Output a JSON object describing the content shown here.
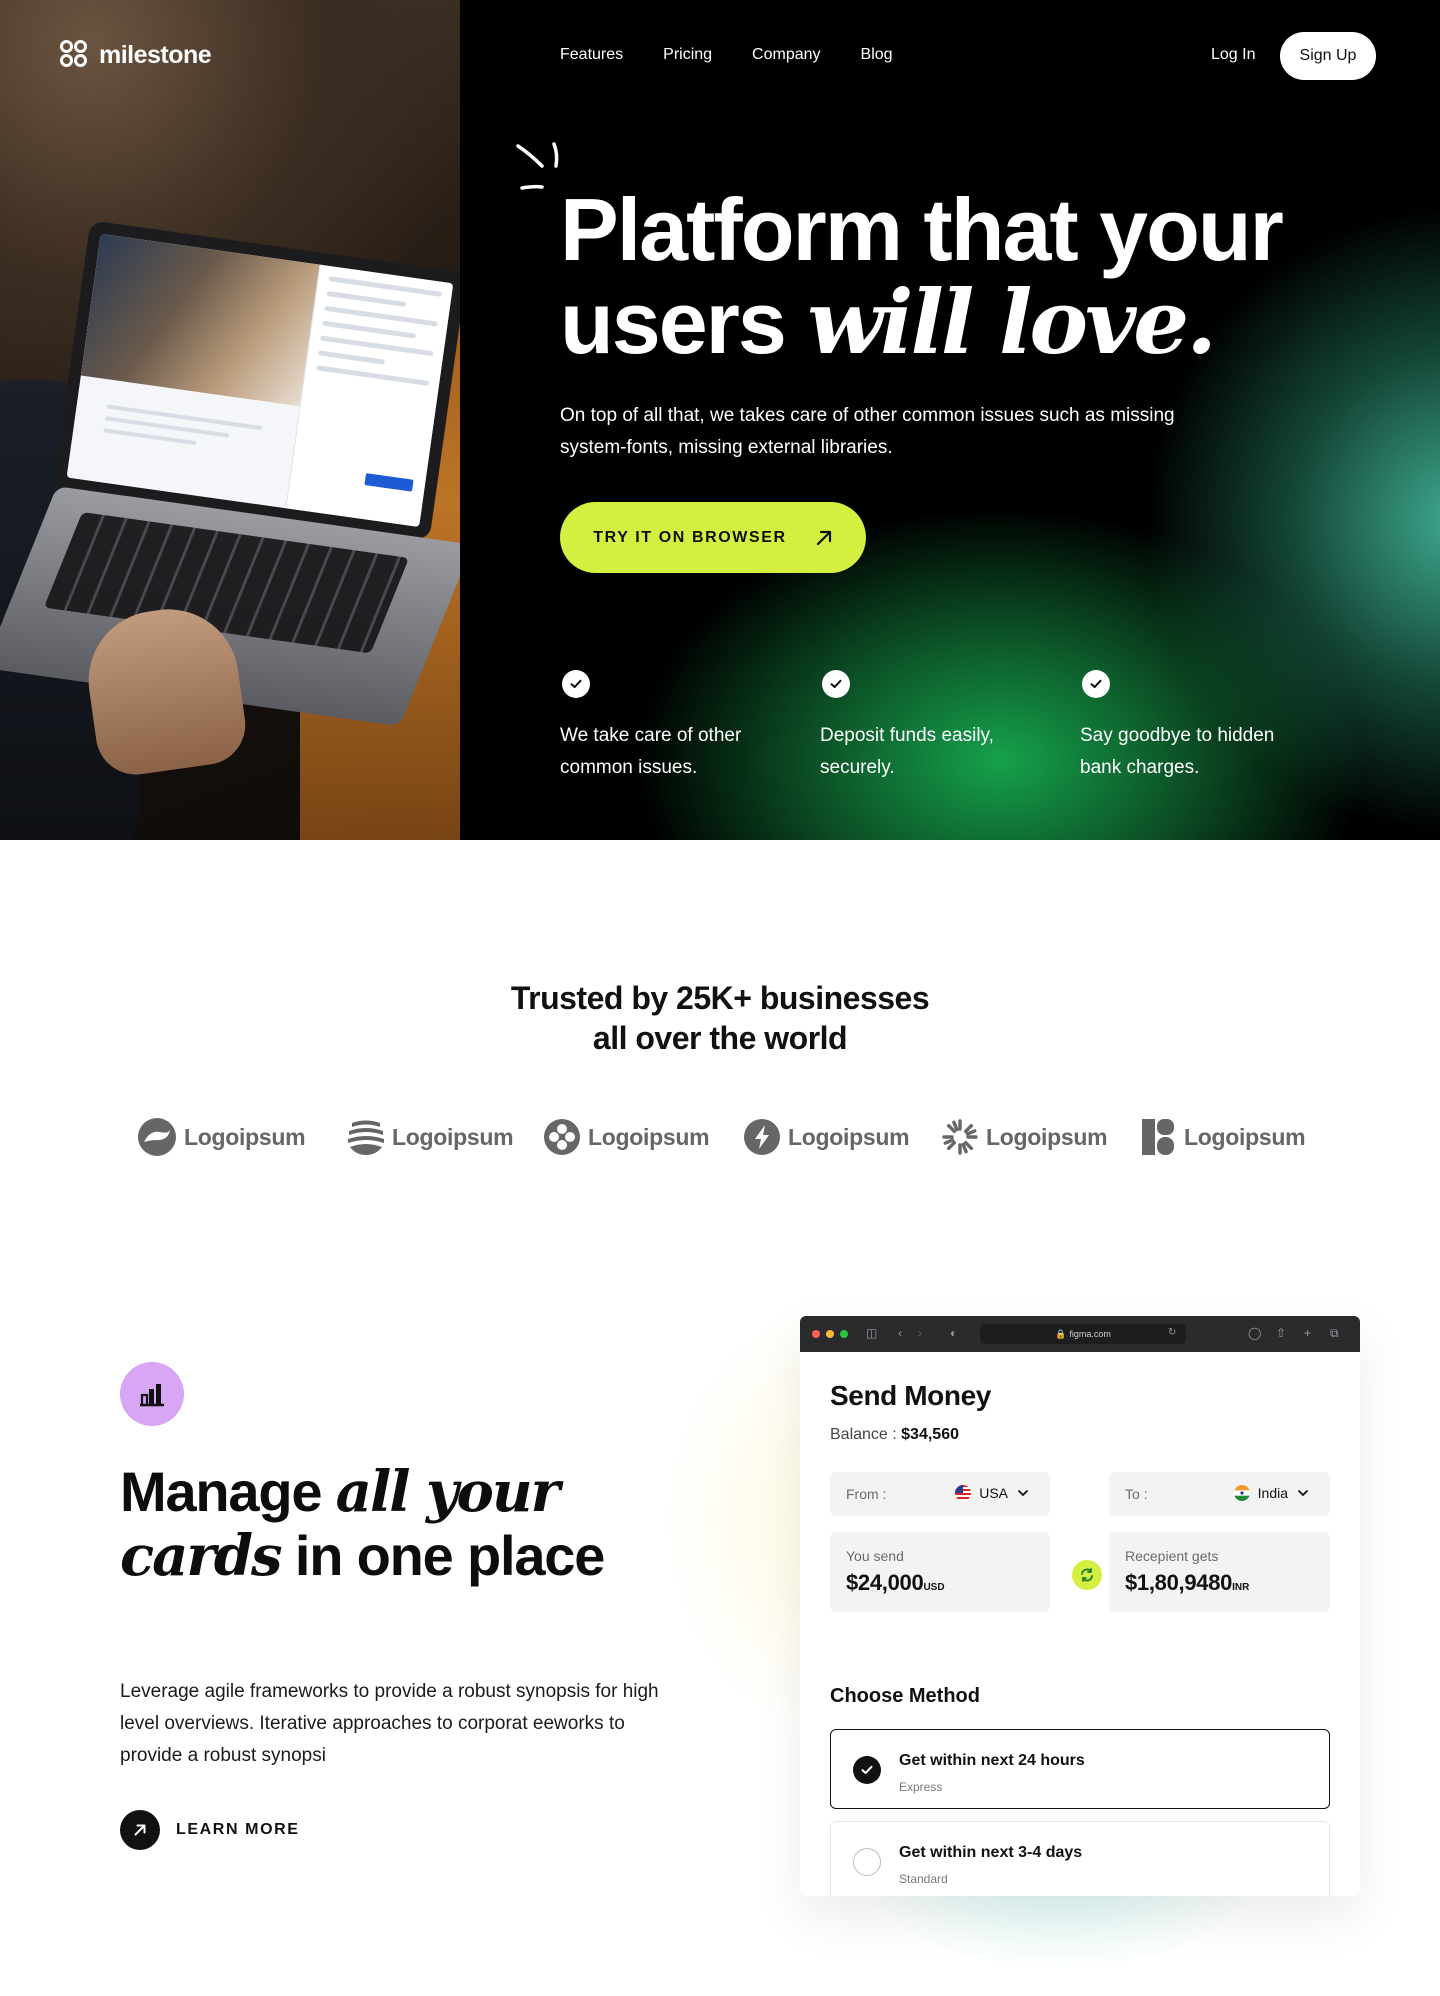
{
  "brand": {
    "name": "milestone"
  },
  "nav": {
    "items": [
      {
        "label": "Features"
      },
      {
        "label": "Pricing"
      },
      {
        "label": "Company"
      },
      {
        "label": "Blog"
      }
    ],
    "login_label": "Log In",
    "signup_label": "Sign Up"
  },
  "hero": {
    "title_line1": "Platform that your",
    "title_line2_plain": "users ",
    "title_line2_italic": "will love.",
    "subtitle": "On top of all that, we takes care of other common issues such as missing system-fonts, missing external libraries.",
    "cta_label": "TRY IT ON BROWSER",
    "features": [
      {
        "text": "We take care of other common issues."
      },
      {
        "text": "Deposit funds easily, securely."
      },
      {
        "text": "Say goodbye to hidden bank charges."
      }
    ]
  },
  "trusted": {
    "title_line1": "Trusted by 25K+ businesses",
    "title_line2": "all over the world",
    "logos": [
      {
        "label": "Logoipsum",
        "icon": "swirl-circle-icon"
      },
      {
        "label": "Logoipsum",
        "icon": "wave-stripes-icon"
      },
      {
        "label": "Logoipsum",
        "icon": "four-dots-circle-icon"
      },
      {
        "label": "Logoipsum",
        "icon": "bolt-circle-icon"
      },
      {
        "label": "Logoipsum",
        "icon": "sunburst-icon"
      },
      {
        "label": "Logoipsum",
        "icon": "block-b-icon"
      }
    ]
  },
  "manage": {
    "title_a": "Manage ",
    "title_b_italic": "all your",
    "title_c_italic": "cards",
    "title_d": " in one place",
    "body": "Leverage agile frameworks to provide a robust synopsis for high level overviews. Iterative approaches to corporat eeworks to provide a robust synopsi",
    "learn_label": "LEARN MORE"
  },
  "send_card": {
    "browser_url": "figma.com",
    "title": "Send Money",
    "balance_label": "Balance : ",
    "balance_value": "$34,560",
    "from_label": "From :",
    "from_value": "USA",
    "to_label": "To :",
    "to_value": "India",
    "send_label": "You send",
    "send_amount": "$24,000",
    "send_unit": "USD",
    "receive_label": "Recepient gets",
    "receive_amount": "$1,80,9480",
    "receive_unit": "INR",
    "method_title": "Choose Method",
    "options": [
      {
        "title": "Get within next 24 hours",
        "subtitle": "Express",
        "selected": true
      },
      {
        "title": "Get within next 3-4 days",
        "subtitle": "Standard",
        "selected": false
      }
    ]
  },
  "colors": {
    "accent_lime": "#d4ef3f",
    "hero_bg": "#000000",
    "badge_purple": "#d9a6f5",
    "glow_green": "#16aa50"
  }
}
